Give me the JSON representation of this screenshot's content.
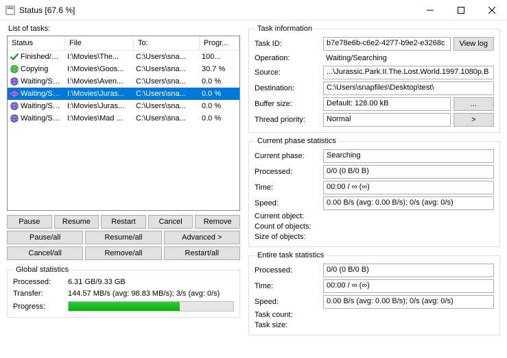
{
  "window": {
    "title": "Status [67.6 %]"
  },
  "labels": {
    "list_of_tasks": "List of tasks:",
    "task_info": "Task information",
    "current_phase_stats": "Current phase statistics",
    "entire_task_stats": "Entire task statistics",
    "global_stats": "Global statistics"
  },
  "columns": {
    "status": "Status",
    "file": "File",
    "to": "To:",
    "progress": "Progr..."
  },
  "tasks": [
    {
      "icon": "check",
      "status": "Finished/C...",
      "file": "I:\\Movies\\The...",
      "to": "C:\\Users\\sna...",
      "progress": "100...",
      "selected": false
    },
    {
      "icon": "globe-green",
      "status": "Copying",
      "file": "I:\\Movies\\Goos...",
      "to": "C:\\Users\\sna...",
      "progress": "30.7 %",
      "selected": false
    },
    {
      "icon": "globe-purple",
      "status": "Waiting/Se...",
      "file": "I:\\Movies\\Aven...",
      "to": "C:\\Users\\sna...",
      "progress": "0.0 %",
      "selected": false
    },
    {
      "icon": "globe-purple",
      "status": "Waiting/Se...",
      "file": "I:\\Movies\\Juras...",
      "to": "C:\\Users\\sna...",
      "progress": "0.0 %",
      "selected": true
    },
    {
      "icon": "globe-purple",
      "status": "Waiting/Se...",
      "file": "I:\\Movies\\Juras...",
      "to": "C:\\Users\\sna...",
      "progress": "0.0 %",
      "selected": false
    },
    {
      "icon": "globe-purple",
      "status": "Waiting/Se...",
      "file": "I:\\Movies\\Mad ...",
      "to": "C:\\Users\\sna...",
      "progress": "0.0 %",
      "selected": false
    }
  ],
  "buttons": {
    "pause": "Pause",
    "resume": "Resume",
    "restart": "Restart",
    "cancel": "Cancel",
    "remove": "Remove",
    "pause_all": "Pause/all",
    "resume_all": "Resume/all",
    "advanced": "Advanced >",
    "cancel_all": "Cancel/all",
    "remove_all": "Remove/all",
    "restart_all": "Restart/all",
    "view_log": "View log",
    "more": "...",
    "caret": ">"
  },
  "global": {
    "processed_label": "Processed:",
    "processed": "6.31 GB/9.33 GB",
    "transfer_label": "Transfer:",
    "transfer": "144.57 MB/s (avg: 98.83 MB/s); 3/s (avg: 0/s)",
    "progress_label": "Progress:",
    "progress_pct": 67.6
  },
  "task_info": {
    "id_label": "Task ID:",
    "id": "b7e78e6b-c6e2-4277-b9e2-e3268c",
    "op_label": "Operation:",
    "op": "Waiting/Searching",
    "src_label": "Source:",
    "src": "...\\Jurassic.Park.II.The.Lost.World.1997.1080p.B",
    "dst_label": "Destination:",
    "dst": "C:\\Users\\snapfiles\\Desktop\\test\\",
    "buf_label": "Buffer size:",
    "buf": "Default: 128.00 kB",
    "prio_label": "Thread priority:",
    "prio": "Normal"
  },
  "phase": {
    "current_label": "Current phase:",
    "current": "Searching",
    "processed_label": "Processed:",
    "processed": "0/0 (0 B/0 B)",
    "time_label": "Time:",
    "time": "00:00 / ∞ (∞)",
    "speed_label": "Speed:",
    "speed": "0.00 B/s (avg: 0.00 B/s); 0/s (avg: 0/s)",
    "cur_obj_label": "Current object:",
    "count_label": "Count of objects:",
    "size_label": "Size of objects:"
  },
  "entire": {
    "processed_label": "Processed:",
    "processed": "0/0 (0 B/0 B)",
    "time_label": "Time:",
    "time": "00:00 / ∞ (∞)",
    "speed_label": "Speed:",
    "speed": "0.00 B/s (avg: 0.00 B/s); 0/s (avg: 0/s)",
    "task_count_label": "Task count:",
    "task_size_label": "Task size:"
  }
}
